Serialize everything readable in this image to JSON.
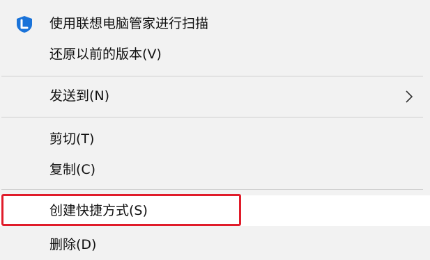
{
  "context_menu": {
    "items": [
      {
        "label": "使用联想电脑管家进行扫描",
        "icon": "lenovo-shield-icon"
      },
      {
        "label": "还原以前的版本(V)"
      },
      {
        "label": "发送到(N)",
        "icon": "chevron-right-icon"
      },
      {
        "label": "剪切(T)"
      },
      {
        "label": "复制(C)"
      },
      {
        "label": "创建快捷方式(S)"
      },
      {
        "label": "删除(D)"
      }
    ],
    "highlight_color": "#e01c2a",
    "accent_color": "#1a73d9"
  }
}
